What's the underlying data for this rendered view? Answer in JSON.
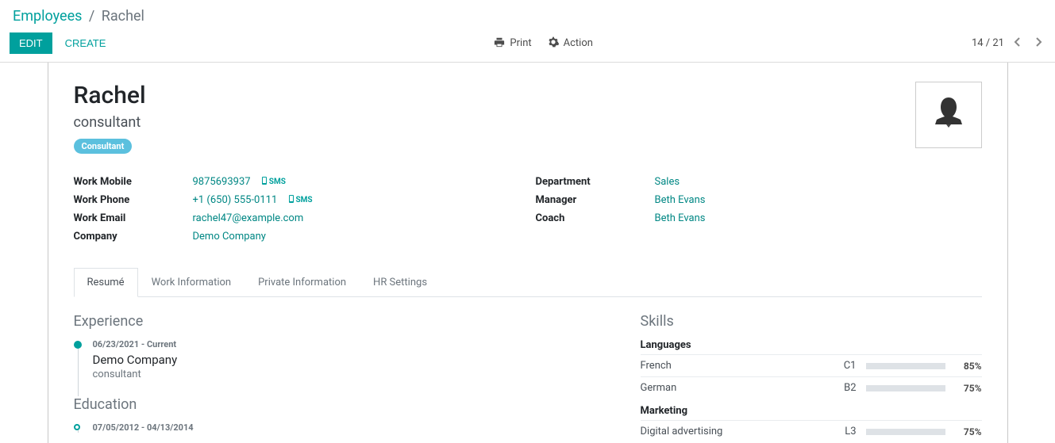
{
  "breadcrumb": {
    "root": "Employees",
    "current": "Rachel"
  },
  "toolbar": {
    "edit": "EDIT",
    "create": "CREATE",
    "print": "Print",
    "action": "Action"
  },
  "pager": {
    "text": "14 / 21"
  },
  "employee": {
    "name": "Rachel",
    "subtitle": "consultant",
    "tag": "Consultant"
  },
  "fields_left": {
    "work_mobile_label": "Work Mobile",
    "work_mobile_value": "9875693937",
    "work_phone_label": "Work Phone",
    "work_phone_value": "+1 (650) 555-0111",
    "work_email_label": "Work Email",
    "work_email_value": "rachel47@example.com",
    "company_label": "Company",
    "company_value": "Demo Company",
    "sms_label": "SMS"
  },
  "fields_right": {
    "department_label": "Department",
    "department_value": "Sales",
    "manager_label": "Manager",
    "manager_value": "Beth Evans",
    "coach_label": "Coach",
    "coach_value": "Beth Evans"
  },
  "tabs": {
    "resume": "Resumé",
    "work_info": "Work Information",
    "private_info": "Private Information",
    "hr_settings": "HR Settings"
  },
  "resume": {
    "experience_title": "Experience",
    "experience_item": {
      "date": "06/23/2021 - Current",
      "title": "Demo Company",
      "subtitle": "consultant"
    },
    "education_title": "Education",
    "education_item": {
      "date": "07/05/2012 - 04/13/2014"
    }
  },
  "skills": {
    "title": "Skills",
    "groups": [
      {
        "name": "Languages",
        "items": [
          {
            "name": "French",
            "level": "C1",
            "pct": "85%",
            "pct_num": 85
          },
          {
            "name": "German",
            "level": "B2",
            "pct": "75%",
            "pct_num": 75
          }
        ]
      },
      {
        "name": "Marketing",
        "items": [
          {
            "name": "Digital advertising",
            "level": "L3",
            "pct": "75%",
            "pct_num": 75
          }
        ]
      }
    ]
  }
}
